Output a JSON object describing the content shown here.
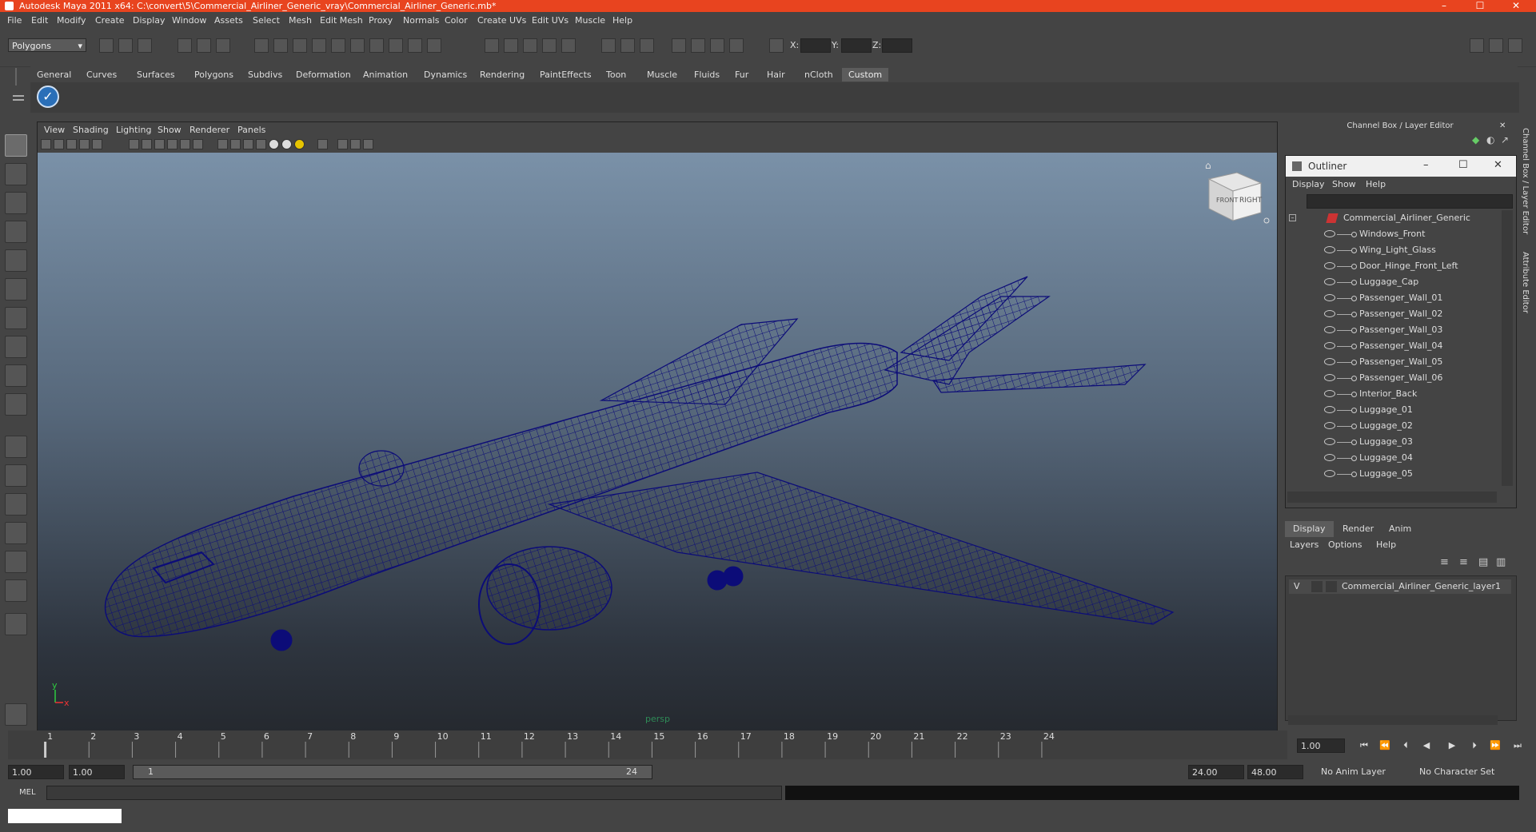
{
  "window": {
    "title": "Autodesk Maya 2011 x64: C:\\convert\\5\\Commercial_Airliner_Generic_vray\\Commercial_Airliner_Generic.mb*",
    "minimize": "–",
    "maximize": "☐",
    "close": "✕",
    "accent": "#e8441f"
  },
  "menubar": [
    "File",
    "Edit",
    "Modify",
    "Create",
    "Display",
    "Window",
    "Assets",
    "Select",
    "Mesh",
    "Edit Mesh",
    "Proxy",
    "Normals",
    "Color",
    "Create UVs",
    "Edit UVs",
    "Muscle",
    "Help"
  ],
  "statusline": {
    "mode": "Polygons",
    "x_label": "X:",
    "y_label": "Y:",
    "z_label": "Z:"
  },
  "shelf": {
    "tabs": [
      "General",
      "Curves",
      "Surfaces",
      "Polygons",
      "Subdivs",
      "Deformation",
      "Animation",
      "Dynamics",
      "Rendering",
      "PaintEffects",
      "Toon",
      "Muscle",
      "Fluids",
      "Fur",
      "Hair",
      "nCloth",
      "Custom"
    ],
    "active_tab": "Custom",
    "icon": "checkmark-icon"
  },
  "viewport": {
    "menu": [
      "View",
      "Shading",
      "Lighting",
      "Show",
      "Renderer",
      "Panels"
    ],
    "camera": "persp",
    "viewcube_front": "FRONT",
    "viewcube_right": "RIGHT",
    "axis_x": "x",
    "axis_y": "y",
    "wire_color": "#0c0c78"
  },
  "channel_box": {
    "title": "Channel Box / Layer Editor"
  },
  "outliner": {
    "title": "Outliner",
    "menu": [
      "Display",
      "Show",
      "Help"
    ],
    "root": "Commercial_Airliner_Generic",
    "items": [
      "Windows_Front",
      "Wing_Light_Glass",
      "Door_Hinge_Front_Left",
      "Luggage_Cap",
      "Passenger_Wall_01",
      "Passenger_Wall_02",
      "Passenger_Wall_03",
      "Passenger_Wall_04",
      "Passenger_Wall_05",
      "Passenger_Wall_06",
      "Interior_Back",
      "Luggage_01",
      "Luggage_02",
      "Luggage_03",
      "Luggage_04",
      "Luggage_05"
    ]
  },
  "layer_editor": {
    "tabs": [
      "Display",
      "Render",
      "Anim"
    ],
    "active_tab": "Display",
    "menu": [
      "Layers",
      "Options",
      "Help"
    ],
    "layer_visible": "V",
    "layer_name": "Commercial_Airliner_Generic_layer1"
  },
  "side_tabs": [
    "Channel Box / Layer Editor",
    "Attribute Editor"
  ],
  "timeline": {
    "start": 1,
    "end": 24,
    "current_frame": "1.00",
    "current_marker": "1"
  },
  "range": {
    "start_time": "1.00",
    "playback_start": "1.00",
    "slider_start": "1",
    "slider_end": "24",
    "playback_end": "24.00",
    "end_time": "48.00",
    "anim_layer": "No Anim Layer",
    "character_set": "No Character Set"
  },
  "command_line": {
    "label": "MEL"
  }
}
